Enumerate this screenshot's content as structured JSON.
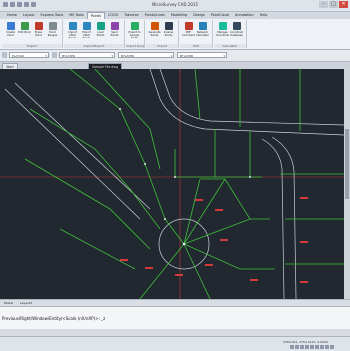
{
  "app": {
    "title": "MicroSurvey CAD 2015"
  },
  "window_buttons": {
    "minimize": "–",
    "maximize": "□",
    "close": "✕"
  },
  "tabs": [
    "Home",
    "Layout",
    "Express Tools",
    "MS Tools",
    "Points",
    "COGO",
    "Traverse",
    "Points/Lines",
    "Modelling",
    "Design",
    "PointCloud",
    "Annotation",
    "Help"
  ],
  "active_tab": "Points",
  "ribbon": {
    "groups": [
      {
        "label": "Export",
        "buttons": [
          {
            "label": "Create Point",
            "color": "#3a7bd5"
          },
          {
            "label": "Edit Point",
            "color": "#3a9a4a"
          },
          {
            "label": "Erase Point",
            "color": "#c0392b"
          },
          {
            "label": "Point Ranges",
            "color": "#7f8c8d"
          }
        ]
      },
      {
        "label": "Import/Export",
        "buttons": [
          {
            "label": "Import ASCII Points",
            "color": "#2e86c1"
          },
          {
            "label": "Export ASCII Points",
            "color": "#2e86c1"
          },
          {
            "label": "Load Points",
            "color": "#16a085"
          },
          {
            "label": "Send Points",
            "color": "#8e44ad"
          }
        ]
      },
      {
        "label": "Import Google",
        "buttons": [
          {
            "label": "Export to Google Earth",
            "color": "#27ae60"
          }
        ]
      },
      {
        "label": "Import",
        "buttons": [
          {
            "label": "Generate Points",
            "color": "#d35400"
          },
          {
            "label": "Inverse Points",
            "color": "#2c3e50"
          }
        ]
      },
      {
        "label": "Edit",
        "buttons": [
          {
            "label": "PDF Command",
            "color": "#c0392b"
          },
          {
            "label": "Network Calculator",
            "color": "#2980b9"
          }
        ]
      },
      {
        "label": "Calculator",
        "buttons": [
          {
            "label": "Manage Coordinates",
            "color": "#1abc9c"
          },
          {
            "label": "Coordinate Database",
            "color": "#34495e"
          }
        ]
      }
    ]
  },
  "properties": {
    "layer": "PLAY.SN",
    "color_combo": "BYLAYER",
    "linetype_combo": "BYLAYER",
    "lineweight_combo": "BYLAYER"
  },
  "doc_tabs": [
    "Start",
    "Sample File.dwg"
  ],
  "active_doc": "Sample File.dwg",
  "layout_tabs": [
    "Model",
    "Layout1"
  ],
  "command_line": "Previous/Right/Window/Entity/<Scale (nX/nXP)>: _z",
  "status": {
    "coords": "5459.091, 2754.3121, 0.0000"
  },
  "colors": {
    "canvas_bg": "#212830",
    "lot_lines": "#3fbf3a",
    "road_lines": "#c9d0d8",
    "annotations": "#d33a3a",
    "axis": "#c23a3a"
  }
}
